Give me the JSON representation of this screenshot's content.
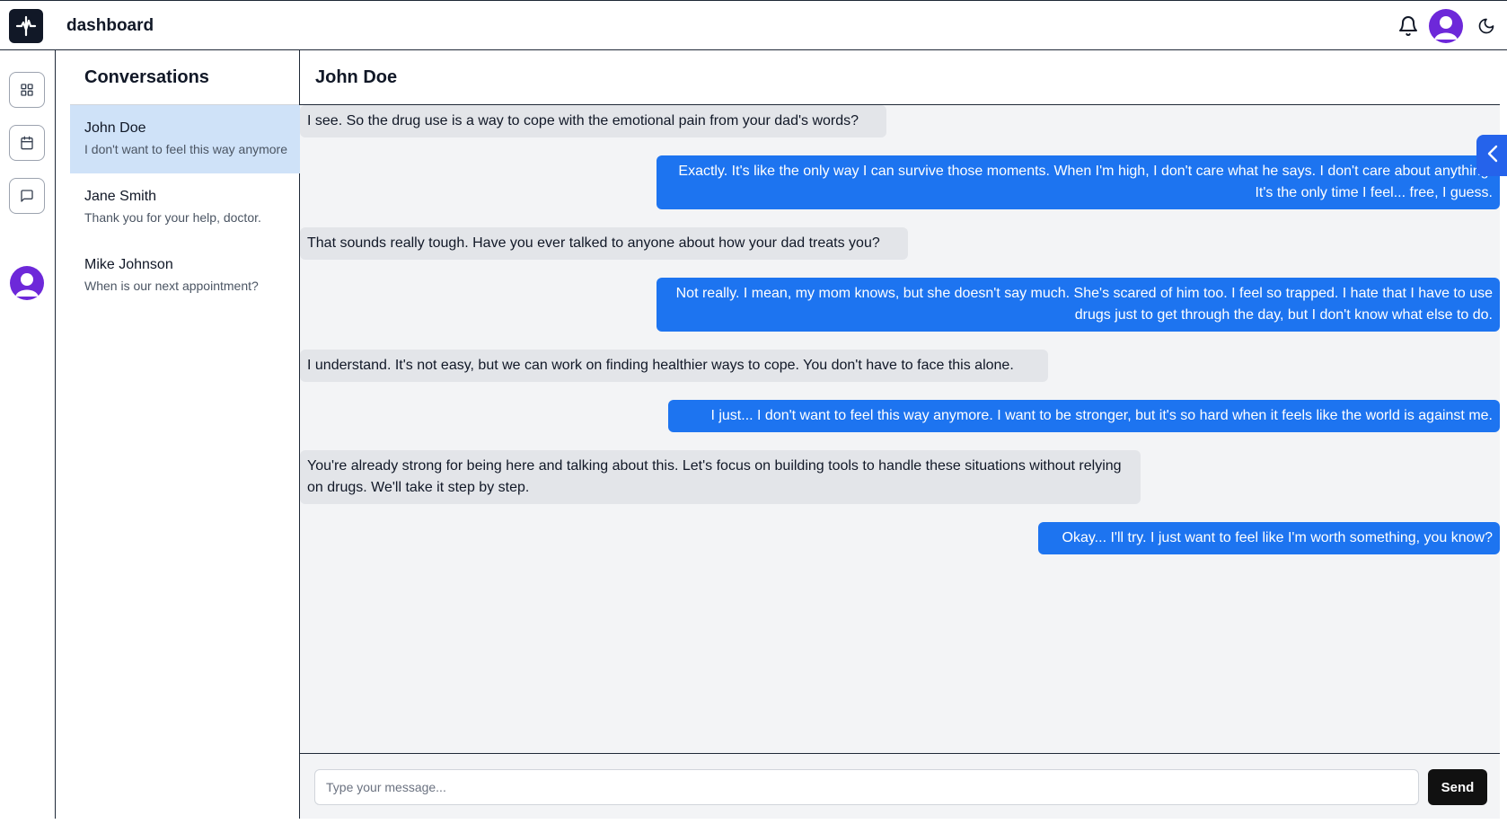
{
  "header": {
    "title": "dashboard",
    "icons": {
      "logo": "medical-logo-icon",
      "notifications": "bell-icon",
      "avatar": "user-avatar-icon",
      "theme": "moon-icon"
    }
  },
  "rail": {
    "items": [
      {
        "icon": "grid-icon",
        "label": "dashboard"
      },
      {
        "icon": "calendar-icon",
        "label": "calendar"
      },
      {
        "icon": "message-icon",
        "label": "messages"
      }
    ]
  },
  "conversations": {
    "title": "Conversations",
    "items": [
      {
        "name": "John Doe",
        "preview": "I don't want to feel this way anymore",
        "active": true
      },
      {
        "name": "Jane Smith",
        "preview": "Thank you for your help, doctor.",
        "active": false
      },
      {
        "name": "Mike Johnson",
        "preview": "When is our next appointment?",
        "active": false
      }
    ]
  },
  "chat": {
    "contact_name": "John Doe",
    "messages": [
      {
        "from": "doctor",
        "text": "I see. So the drug use is a way to cope with the emotional pain from your dad's words?"
      },
      {
        "from": "patient",
        "text": "Exactly. It's like the only way I can survive those moments. When I'm high, I don't care what he says. I don't care about anything. It's the only time I feel... free, I guess."
      },
      {
        "from": "doctor",
        "text": "That sounds really tough. Have you ever talked to anyone about how your dad treats you?"
      },
      {
        "from": "patient",
        "text": "Not really. I mean, my mom knows, but she doesn't say much. She's scared of him too. I feel so trapped. I hate that I have to use drugs just to get through the day, but I don't know what else to do."
      },
      {
        "from": "doctor",
        "text": "I understand. It's not easy, but we can work on finding healthier ways to cope. You don't have to face this alone."
      },
      {
        "from": "patient",
        "text": "I just... I don't want to feel this way anymore. I want to be stronger, but it's so hard when it feels like the world is against me."
      },
      {
        "from": "doctor",
        "text": "You're already strong for being here and talking about this. Let's focus on building tools to handle these situations without relying on drugs. We'll take it step by step."
      },
      {
        "from": "patient",
        "text": "Okay... I'll try. I just want to feel like I'm worth something, you know?"
      }
    ]
  },
  "composer": {
    "placeholder": "Type your message...",
    "value": "",
    "send_label": "Send"
  },
  "colors": {
    "accent": "#1d74f0",
    "incoming_bubble": "#e3e5e9",
    "active_conversation": "#cfe2f8",
    "avatar": "#6d28d9"
  }
}
